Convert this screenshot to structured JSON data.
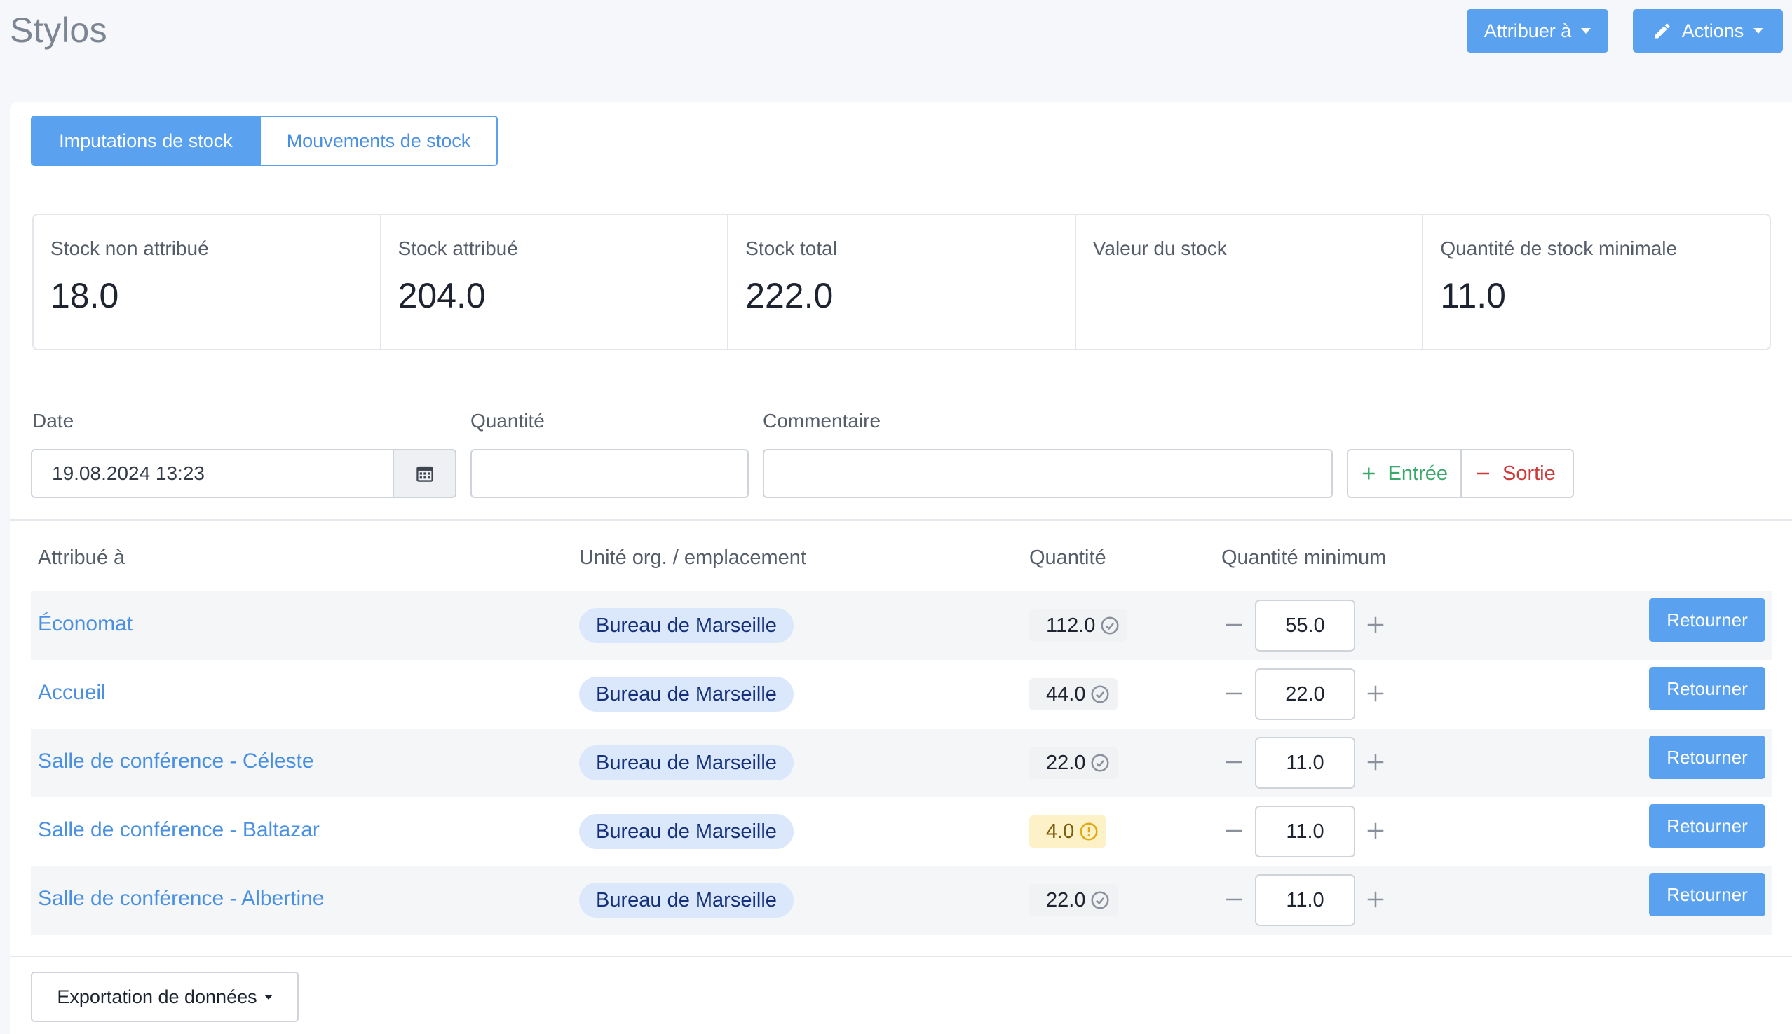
{
  "header": {
    "title": "Stylos",
    "assign_label": "Attribuer à",
    "actions_label": "Actions"
  },
  "tabs": [
    {
      "label": "Imputations de stock",
      "active": true
    },
    {
      "label": "Mouvements de stock",
      "active": false
    }
  ],
  "stats": [
    {
      "label": "Stock non attribué",
      "value": "18.0"
    },
    {
      "label": "Stock attribué",
      "value": "204.0"
    },
    {
      "label": "Stock total",
      "value": "222.0"
    },
    {
      "label": "Valeur du stock",
      "value": ""
    },
    {
      "label": "Quantité de stock minimale",
      "value": "11.0"
    }
  ],
  "form": {
    "date_label": "Date",
    "date_value": "19.08.2024 13:23",
    "quantity_label": "Quantité",
    "quantity_value": "",
    "comment_label": "Commentaire",
    "comment_value": "",
    "in_label": "Entrée",
    "out_label": "Sortie"
  },
  "table": {
    "headers": {
      "assigned_to": "Attribué à",
      "location": "Unité org. / emplacement",
      "quantity": "Quantité",
      "min_quantity": "Quantité minimum"
    },
    "rows": [
      {
        "assigned_to": "Économat",
        "location": "Bureau de Marseille",
        "quantity": "112.0",
        "status": "ok",
        "min_quantity": "55.0",
        "return_label": "Retourner"
      },
      {
        "assigned_to": "Accueil",
        "location": "Bureau de Marseille",
        "quantity": "44.0",
        "status": "ok",
        "min_quantity": "22.0",
        "return_label": "Retourner"
      },
      {
        "assigned_to": "Salle de conférence - Céleste",
        "location": "Bureau de Marseille",
        "quantity": "22.0",
        "status": "ok",
        "min_quantity": "11.0",
        "return_label": "Retourner"
      },
      {
        "assigned_to": "Salle de conférence - Baltazar",
        "location": "Bureau de Marseille",
        "quantity": "4.0",
        "status": "warning",
        "min_quantity": "11.0",
        "return_label": "Retourner"
      },
      {
        "assigned_to": "Salle de conférence - Albertine",
        "location": "Bureau de Marseille",
        "quantity": "22.0",
        "status": "ok",
        "min_quantity": "11.0",
        "return_label": "Retourner"
      }
    ]
  },
  "footer": {
    "export_label": "Exportation de données"
  },
  "colors": {
    "primary": "#5aa1f0",
    "link": "#4a90e2",
    "success": "#39a86a",
    "danger": "#cc3b3b",
    "warning_bg": "#fdf1c7"
  }
}
